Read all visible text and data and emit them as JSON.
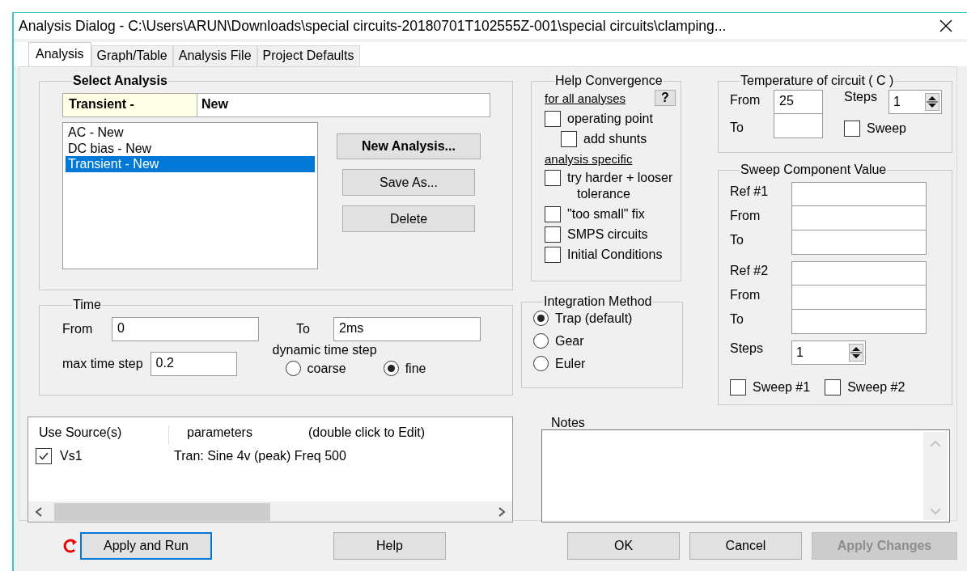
{
  "window": {
    "title": "Analysis Dialog - C:\\Users\\ARUN\\Downloads\\special circuits-20180701T102555Z-001\\special circuits\\clamping..."
  },
  "tabs": [
    {
      "label": "Analysis",
      "selected": true
    },
    {
      "label": "Graph/Table",
      "selected": false
    },
    {
      "label": "Analysis File",
      "selected": false
    },
    {
      "label": "Project Defaults",
      "selected": false
    }
  ],
  "select_analysis": {
    "title": "Select Analysis",
    "type_label": "Transient -",
    "name_value": "New",
    "list": [
      {
        "label": "AC - New",
        "selected": false
      },
      {
        "label": "DC bias - New",
        "selected": false
      },
      {
        "label": "Transient - New",
        "selected": true
      }
    ],
    "buttons": [
      {
        "label": "New Analysis...",
        "kind": "default"
      },
      {
        "label": "Save As...",
        "kind": "normal"
      },
      {
        "label": "Delete",
        "kind": "normal"
      }
    ]
  },
  "time": {
    "title": "Time",
    "from_label": "From",
    "from_value": "0",
    "to_label": "To",
    "to_value": "2ms",
    "max_step_label": "max time step",
    "max_step_value": "0.2",
    "dynamic_label": "dynamic time step",
    "options": [
      {
        "label": "coarse",
        "selected": false
      },
      {
        "label": "fine",
        "selected": true
      }
    ]
  },
  "help_convergence": {
    "title": "Help Convergence",
    "all_heading": "for all analyses",
    "help_button": "?",
    "all_options": [
      {
        "label": "operating point",
        "checked": false,
        "children": [
          {
            "label": "add shunts",
            "checked": false
          }
        ]
      }
    ],
    "specific_heading": "analysis specific",
    "specific_options": [
      {
        "label": "try harder + looser tolerance",
        "checked": false
      },
      {
        "label": "\"too small\" fix",
        "checked": false
      },
      {
        "label": "SMPS circuits",
        "checked": false
      },
      {
        "label": "Initial Conditions",
        "checked": false
      }
    ]
  },
  "integration": {
    "title": "Integration Method",
    "options": [
      {
        "label": "Trap (default)",
        "selected": true
      },
      {
        "label": "Gear",
        "selected": false
      },
      {
        "label": "Euler",
        "selected": false
      }
    ]
  },
  "temperature": {
    "title": "Temperature of circuit  ( C )",
    "from_label": "From",
    "from_value": "25",
    "to_label": "To",
    "steps_label": "Steps",
    "steps_value": "1",
    "sweep": {
      "label": "Sweep",
      "checked": false
    }
  },
  "sweep_component": {
    "title": "Sweep Component Value",
    "refs": [
      {
        "ref_label": "Ref #1",
        "from_label": "From",
        "to_label": "To"
      },
      {
        "ref_label": "Ref #2",
        "from_label": "From",
        "to_label": "To"
      }
    ],
    "steps_label": "Steps",
    "steps_value": "1",
    "sweeps": [
      {
        "label": "Sweep #1",
        "checked": false
      },
      {
        "label": "Sweep #2",
        "checked": false
      }
    ]
  },
  "sources": {
    "columns": [
      "Use Source(s)",
      "parameters",
      "(double click to Edit)"
    ],
    "rows": [
      {
        "source": "Vs1",
        "checked": true,
        "parameters": "Tran: Sine  4v (peak)  Freq 500"
      }
    ]
  },
  "notes": {
    "label": "Notes"
  },
  "buttons": [
    {
      "label": "Apply and Run",
      "kind": "run",
      "disabled": false
    },
    {
      "label": "Help",
      "kind": "normal",
      "disabled": false
    },
    {
      "label": "OK",
      "kind": "normal",
      "disabled": false
    },
    {
      "label": "Cancel",
      "kind": "normal",
      "disabled": false
    },
    {
      "label": "Apply Changes",
      "kind": "normal",
      "disabled": true
    }
  ]
}
